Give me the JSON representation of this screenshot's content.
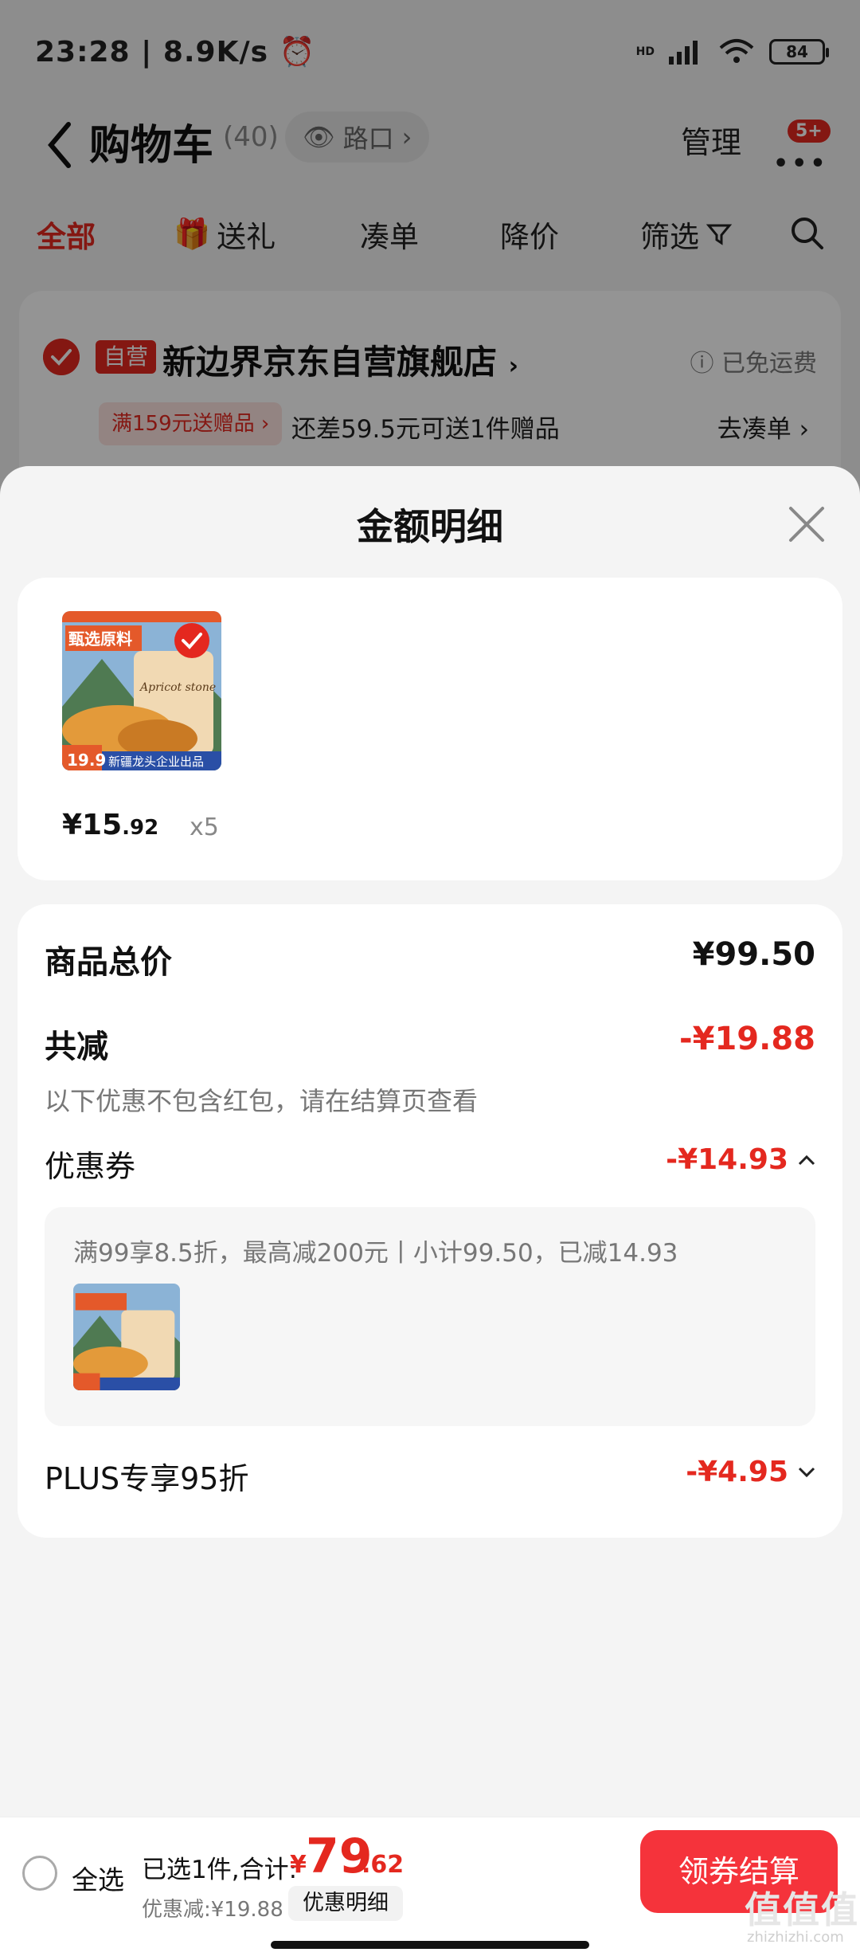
{
  "status": {
    "time": "23:28",
    "speed": "8.9K/s",
    "network": "HD",
    "battery": "84"
  },
  "navbar": {
    "title": "购物车",
    "count": "(40)",
    "location": "路口",
    "manage": "管理",
    "more_badge": "5+"
  },
  "tabs": [
    {
      "label": "全部"
    },
    {
      "label": "送礼"
    },
    {
      "label": "凑单"
    },
    {
      "label": "降价"
    },
    {
      "label": "筛选"
    }
  ],
  "shop": {
    "badge": "自营",
    "name": "新边界京东自营旗舰店",
    "free_shipping": "已免运费",
    "gift_tag": "满159元送赠品",
    "gift_text": "还差59.5元可送1件赠品",
    "gift_action": "去凑单"
  },
  "sheet": {
    "title": "金额明细",
    "item": {
      "price_int": "¥15",
      "price_dec": ".92",
      "qty": "x5"
    },
    "total_label": "商品总价",
    "total_value": "¥99.50",
    "reduce_label": "共减",
    "reduce_value": "-¥19.88",
    "reduce_note": "以下优惠不包含红包，请在结算页查看",
    "coupon_label": "优惠券",
    "coupon_value": "-¥14.93",
    "coupon_desc": "满99享8.5折，最高减200元丨小计99.50，已减14.93",
    "plus_label": "PLUS专享95折",
    "plus_value": "-¥4.95"
  },
  "bottom": {
    "select_all": "全选",
    "sum_label": "已选1件,合计:",
    "currency": "¥",
    "sum_int": "79",
    "sum_dec": ".62",
    "discount": "优惠减:¥19.88",
    "detail": "优惠明细",
    "checkout": "领券结算"
  },
  "product_image": {
    "title": "甄选原料",
    "subtitle": "Apricot stone",
    "price": "19.9",
    "footer": "新疆龙头企业出品"
  },
  "watermark": {
    "main": "值值值",
    "sub": "zhizhizhi.com"
  },
  "colors": {
    "accent": "#e4281f",
    "checkout": "#f5333b"
  }
}
